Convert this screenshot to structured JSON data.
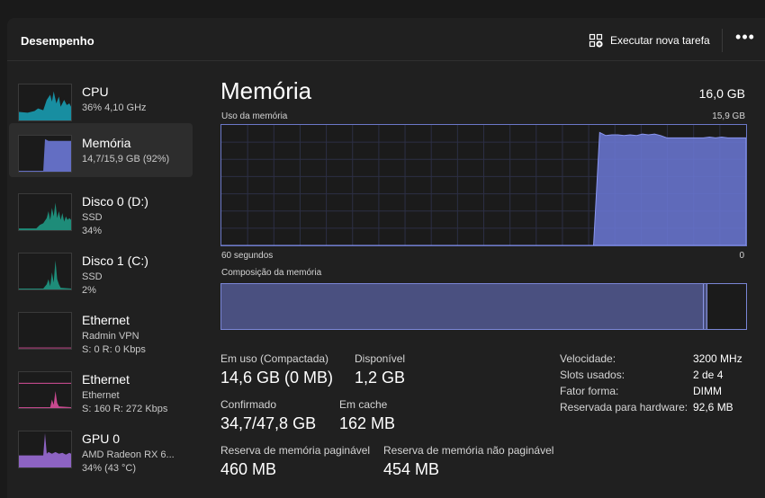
{
  "header": {
    "title": "Desempenho",
    "run_task_label": "Executar nova tarefa",
    "more_label": "•••"
  },
  "sidebar": {
    "items": [
      {
        "name": "CPU",
        "sub1": "36%  4,10 GHz",
        "sub2": "",
        "color": "#17a2b8"
      },
      {
        "name": "Memória",
        "sub1": "14,7/15,9 GB (92%)",
        "sub2": "",
        "color": "#6b78d6"
      },
      {
        "name": "Disco 0 (D:)",
        "sub1": "SSD",
        "sub2": "34%",
        "color": "#1fa08a"
      },
      {
        "name": "Disco 1 (C:)",
        "sub1": "SSD",
        "sub2": "2%",
        "color": "#1fa08a"
      },
      {
        "name": "Ethernet",
        "sub1": "Radmin VPN",
        "sub2": "S: 0 R: 0 Kbps",
        "color": "#d94f9b"
      },
      {
        "name": "Ethernet",
        "sub1": "Ethernet",
        "sub2": "S: 160 R: 272 Kbps",
        "color": "#d94f9b"
      },
      {
        "name": "GPU 0",
        "sub1": "AMD Radeon RX 6...",
        "sub2": "34% (43 °C)",
        "color": "#9a6bd6"
      }
    ]
  },
  "main": {
    "title": "Memória",
    "total": "16,0 GB",
    "usage_label": "Uso da memória",
    "usage_max": "15,9 GB",
    "time_label": "60 segundos",
    "zero_label": "0",
    "composition_label": "Composição da memória",
    "stats": {
      "in_use_label": "Em uso (Compactada)",
      "in_use_value": "14,6 GB (0 MB)",
      "available_label": "Disponível",
      "available_value": "1,2 GB",
      "committed_label": "Confirmado",
      "committed_value": "34,7/47,8 GB",
      "cached_label": "Em cache",
      "cached_value": "162 MB",
      "paged_label": "Reserva de memória paginável",
      "paged_value": "460 MB",
      "nonpaged_label": "Reserva de memória não paginável",
      "nonpaged_value": "454 MB"
    },
    "specs": {
      "speed_label": "Velocidade:",
      "speed_value": "3200 MHz",
      "slots_label": "Slots usados:",
      "slots_value": "2 de 4",
      "form_label": "Fator forma:",
      "form_value": "DIMM",
      "reserved_label": "Reservada para hardware:",
      "reserved_value": "92,6 MB"
    }
  },
  "chart_data": {
    "type": "area",
    "title": "",
    "xlabel": "",
    "ylabel": "",
    "x_range_seconds": [
      60,
      0
    ],
    "ylim": [
      0,
      15.9
    ],
    "series": [
      {
        "values": [
          0,
          0,
          0,
          0,
          0,
          0,
          0,
          0,
          0,
          0,
          0,
          0,
          0,
          0,
          0,
          0,
          0,
          0,
          0,
          0,
          0,
          0,
          0,
          0,
          0,
          0,
          0,
          0,
          0,
          0,
          0,
          0,
          0,
          0,
          0,
          0,
          0,
          0,
          0,
          0,
          0,
          0,
          0,
          0,
          0,
          0,
          0,
          0,
          0,
          0,
          0,
          0,
          0,
          0,
          0,
          0,
          0,
          0,
          0,
          0,
          0,
          0,
          14.9,
          14.5,
          14.6,
          14.6,
          14.5,
          14.6,
          14.5,
          14.7,
          14.6,
          14.7,
          14.5,
          14.2,
          14.2,
          14.2,
          14.2,
          14.2,
          14.2,
          14.2,
          14.3,
          14.2,
          14.3,
          14.2,
          14.2,
          14.2,
          14.2
        ],
        "color": "#6b78d6"
      }
    ]
  },
  "composition": {
    "in_use_fraction": 0.92,
    "modified_fraction": 0.006
  }
}
